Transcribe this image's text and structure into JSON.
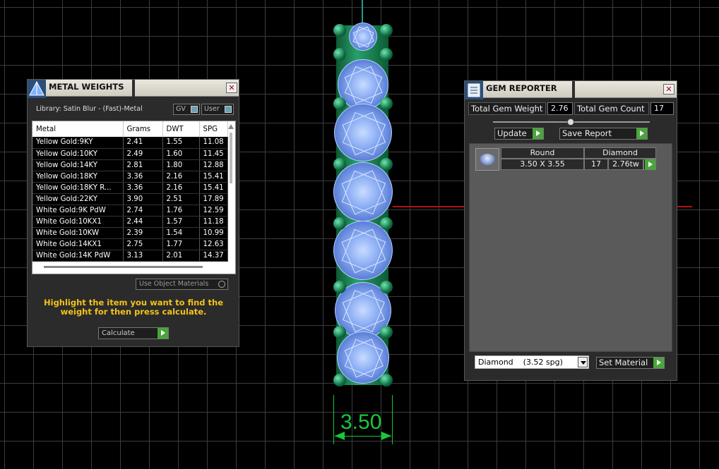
{
  "viewport": {
    "dimension_label": "3.50"
  },
  "metal_weights": {
    "title": "METAL WEIGHTS",
    "library_label": "Library: Satin Blur - (Fast)-Metal",
    "toggle_gv": "GV",
    "toggle_user": "User",
    "columns": [
      "Metal",
      "Grams",
      "DWT",
      "SPG"
    ],
    "rows": [
      [
        "Yellow Gold:9KY",
        "2.41",
        "1.55",
        "11.08"
      ],
      [
        "Yellow Gold:10KY",
        "2.49",
        "1.60",
        "11.45"
      ],
      [
        "Yellow Gold:14KY",
        "2.81",
        "1.80",
        "12.88"
      ],
      [
        "Yellow Gold:18KY",
        "3.36",
        "2.16",
        "15.41"
      ],
      [
        "Yellow Gold:18KY R...",
        "3.36",
        "2.16",
        "15.41"
      ],
      [
        "Yellow Gold:22KY",
        "3.90",
        "2.51",
        "17.89"
      ],
      [
        "White Gold:9K PdW",
        "2.74",
        "1.76",
        "12.59"
      ],
      [
        "White Gold:10KX1",
        "2.44",
        "1.57",
        "11.18"
      ],
      [
        "White Gold:10KW",
        "2.39",
        "1.54",
        "10.99"
      ],
      [
        "White Gold:14KX1",
        "2.75",
        "1.77",
        "12.63"
      ],
      [
        "White Gold:14K PdW",
        "3.13",
        "2.01",
        "14.37"
      ]
    ],
    "use_object_materials": "Use Object Materials",
    "hint": "Highlight the item you want to find the weight for then press calculate.",
    "calculate_label": "Calculate"
  },
  "gem_reporter": {
    "title": "GEM REPORTER",
    "total_weight_label": "Total Gem Weight",
    "total_weight_value": "2.76",
    "total_count_label": "Total Gem Count",
    "total_count_value": "17",
    "update_label": "Update",
    "save_report_label": "Save Report",
    "gem": {
      "cut": "Round",
      "material": "Diamond",
      "size": "3.50 X 3.55",
      "count": "17",
      "weight": "2.76tw"
    },
    "material_select": "Diamond    (3.52 spg)",
    "set_material_label": "Set Material"
  },
  "colors": {
    "accent_yellow": "#f2c21b",
    "go_green": "#49a53b",
    "dimension_green": "#18c83a",
    "axis_red": "#b01010"
  }
}
